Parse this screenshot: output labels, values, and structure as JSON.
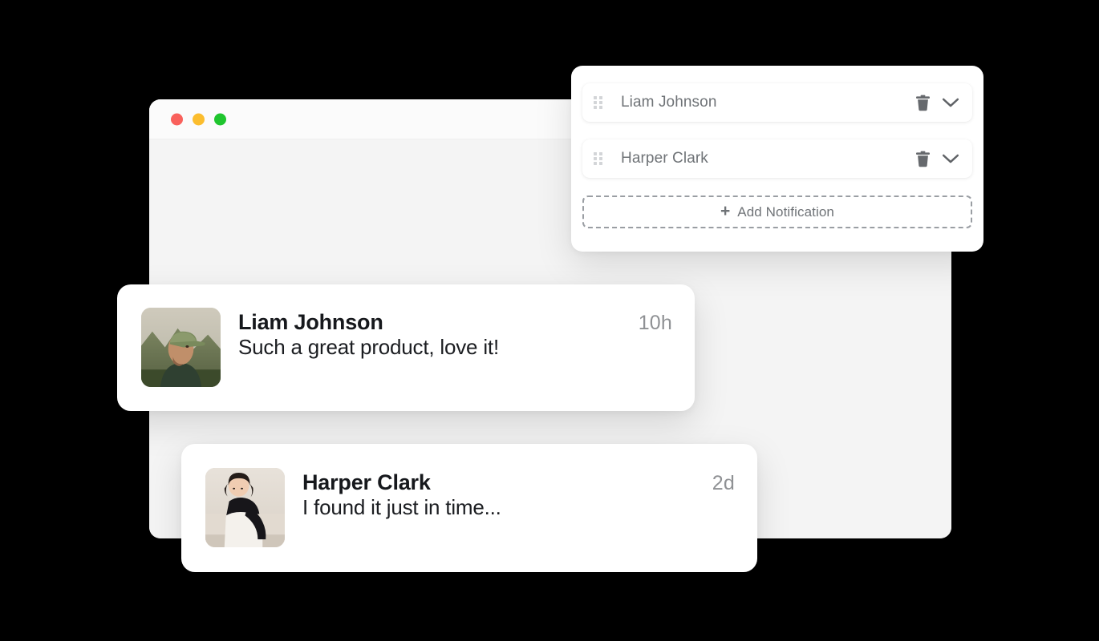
{
  "window": {
    "traffic_lights": [
      {
        "name": "close",
        "color": "#f9615c"
      },
      {
        "name": "minimize",
        "color": "#fbbd2e"
      },
      {
        "name": "maximize",
        "color": "#1fc52e"
      }
    ]
  },
  "settings_panel": {
    "rows": [
      {
        "name": "Liam Johnson",
        "drag_icon": "drag-handle-icon",
        "delete_icon": "trash-icon",
        "expand_icon": "chevron-down-icon"
      },
      {
        "name": "Harper Clark",
        "drag_icon": "drag-handle-icon",
        "delete_icon": "trash-icon",
        "expand_icon": "chevron-down-icon"
      }
    ],
    "add_button": {
      "plus": "+",
      "label": "Add Notification",
      "icon": "plus-icon"
    }
  },
  "notification_cards": [
    {
      "avatar_alt": "man-in-cap-avatar",
      "name": "Liam Johnson",
      "time": "10h",
      "message": "Such a great product, love it!"
    },
    {
      "avatar_alt": "woman-on-sofa-avatar",
      "name": "Harper Clark",
      "time": "2d",
      "message": "I found it just in time..."
    }
  ],
  "colors": {
    "background": "#000000",
    "window_body": "#f4f4f4",
    "window_titlebar": "#fbfbfb",
    "card_surface": "#ffffff",
    "muted_text": "#6f7377",
    "strong_text": "#16181c",
    "timestamp_text": "#8f9194",
    "dashed_border": "#9a9ea3",
    "drag_dot": "#d3d5d8",
    "icon_gray": "#66696d"
  }
}
